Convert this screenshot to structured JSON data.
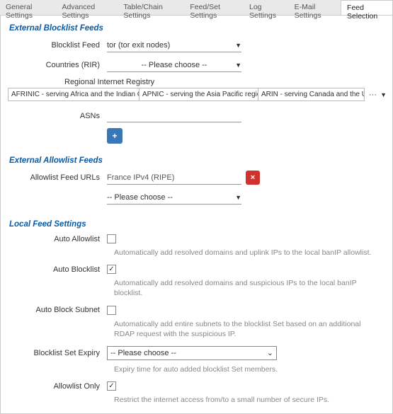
{
  "tabs": {
    "general": "General Settings",
    "advanced": "Advanced Settings",
    "table_chain": "Table/Chain Settings",
    "feed_set": "Feed/Set Settings",
    "log": "Log Settings",
    "email": "E-Mail Settings",
    "feed_selection": "Feed Selection"
  },
  "sections": {
    "ext_block": "External Blocklist Feeds",
    "ext_allow": "External Allowlist Feeds",
    "local": "Local Feed Settings"
  },
  "block": {
    "feed_label": "Blocklist Feed",
    "feed_value": "tor (tor exit nodes)",
    "countries_label": "Countries (RIR)",
    "countries_value": "-- Please choose --",
    "rir_label": "Regional Internet Registry",
    "rir_opts": {
      "a": "AFRINIC - serving Africa and the Indian Ocean region",
      "b": "APNIC - serving the Asia Pacific region",
      "c": "ARIN - serving Canada and the United States"
    },
    "rir_ellipsis": "···",
    "asns_label": "ASNs"
  },
  "allow": {
    "urls_label": "Allowlist Feed URLs",
    "urls_value": "France IPv4 (RIPE)",
    "extra_value": "-- Please choose --"
  },
  "local": {
    "auto_allow_label": "Auto Allowlist",
    "auto_allow_checked": false,
    "auto_allow_help": "Automatically add resolved domains and uplink IPs to the local banIP allowlist.",
    "auto_block_label": "Auto Blocklist",
    "auto_block_checked": true,
    "auto_block_help": "Automatically add resolved domains and suspicious IPs to the local banIP blocklist.",
    "auto_subnet_label": "Auto Block Subnet",
    "auto_subnet_checked": false,
    "auto_subnet_help": "Automatically add entire subnets to the blocklist Set based on an additional RDAP request with the suspicious IP.",
    "expiry_label": "Blocklist Set Expiry",
    "expiry_value": "-- Please choose --",
    "expiry_help": "Expiry time for auto added blocklist Set members.",
    "allow_only_label": "Allowlist Only",
    "allow_only_checked": true,
    "allow_only_help": "Restrict the internet access from/to a small number of secure IPs."
  },
  "glyph": {
    "caret": "▼",
    "plus": "+",
    "cross": "×",
    "check": "✓",
    "sel_caret": "⌄"
  }
}
